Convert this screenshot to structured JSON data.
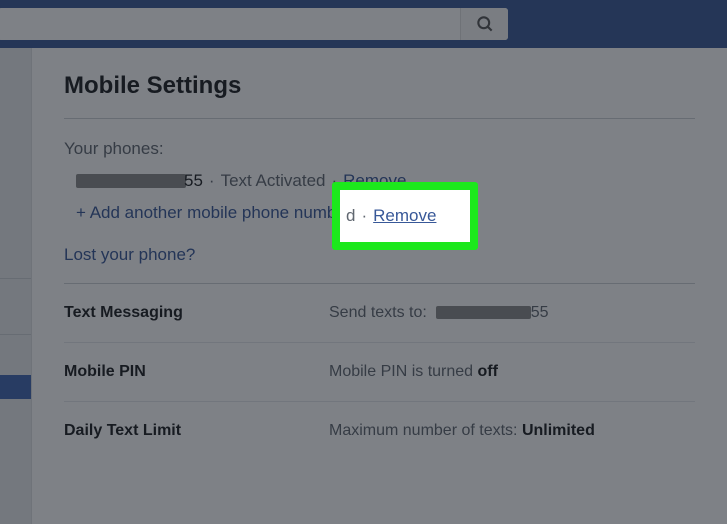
{
  "search": {
    "placeholder": ""
  },
  "page": {
    "title": "Mobile Settings"
  },
  "phones": {
    "section_label": "Your phones:",
    "entry": {
      "suffix": "55",
      "status": "Text Activated",
      "remove": "Remove"
    },
    "add_label": "+ Add another mobile phone number",
    "lost_label": "Lost your phone?"
  },
  "rows": {
    "text_messaging": {
      "label": "Text Messaging",
      "value_prefix": "Send texts to:",
      "value_suffix": "55"
    },
    "mobile_pin": {
      "label": "Mobile PIN",
      "value_prefix": "Mobile PIN is turned",
      "value_strong": "off"
    },
    "daily_limit": {
      "label": "Daily Text Limit",
      "value_prefix": "Maximum number of texts:",
      "value_strong": "Unlimited"
    }
  },
  "highlight": {
    "frag": "d",
    "remove": "Remove"
  }
}
